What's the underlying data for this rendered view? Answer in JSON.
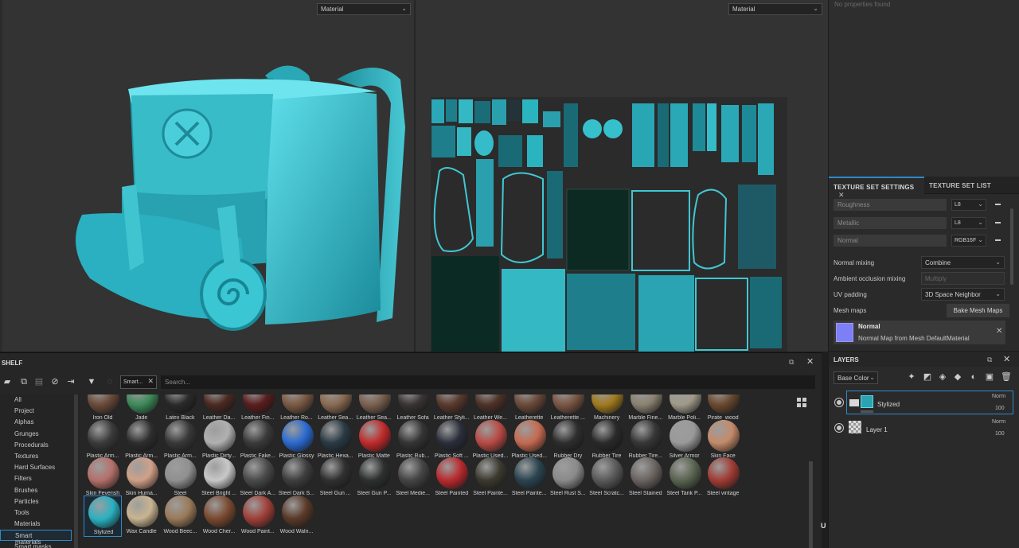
{
  "viewport_3d": {
    "mode_label": "Material"
  },
  "viewport_2d": {
    "mode_label": "Material"
  },
  "properties": {
    "empty_text": "No properties found"
  },
  "texture_set": {
    "tabs": [
      "TEXTURE SET SETTINGS",
      "TEXTURE SET LIST"
    ],
    "channels": [
      {
        "name": "Roughness",
        "format": "L8"
      },
      {
        "name": "Metallic",
        "format": "L8"
      },
      {
        "name": "Normal",
        "format": "RGB16F"
      }
    ],
    "normal_mixing": {
      "label": "Normal mixing",
      "value": "Combine"
    },
    "ao_mixing": {
      "label": "Ambient occlusion mixing",
      "value": "Multiply"
    },
    "uv_padding": {
      "label": "UV padding",
      "value": "3D Space Neighbor"
    },
    "mesh_maps": {
      "label": "Mesh maps",
      "button": "Bake Mesh Maps"
    },
    "mesh_map_item": {
      "title": "Normal",
      "subtitle": "Normal Map from Mesh DefaultMaterial"
    }
  },
  "layers": {
    "title": "LAYERS",
    "blend_channel": "Base Color",
    "items": [
      {
        "name": "Stylized",
        "blend": "Norm",
        "opacity": "100"
      },
      {
        "name": "Layer 1",
        "blend": "Norm",
        "opacity": "100"
      }
    ]
  },
  "shelf": {
    "title": "SHELF",
    "filter_chip": "Smart...",
    "search_placeholder": "Search...",
    "categories": [
      "All",
      "Project",
      "Alphas",
      "Grunges",
      "Procedurals",
      "Textures",
      "Hard Surfaces",
      "Filters",
      "Brushes",
      "Particles",
      "Tools",
      "Materials",
      "Smart materials",
      "Smart masks"
    ],
    "selected_category": "Smart materials",
    "materials": [
      {
        "name": "Iron Old",
        "color": "#6b4a3a"
      },
      {
        "name": "Jade",
        "color": "#3e8a5a"
      },
      {
        "name": "Latex Black",
        "color": "#2a2a2a"
      },
      {
        "name": "Leather Da...",
        "color": "#4a2a22"
      },
      {
        "name": "Leather Fin...",
        "color": "#5a1e1e"
      },
      {
        "name": "Leather Ro...",
        "color": "#7a5a44"
      },
      {
        "name": "Leather Sea...",
        "color": "#8a6a52"
      },
      {
        "name": "Leather Sea...",
        "color": "#7a6050"
      },
      {
        "name": "Leather Sofa",
        "color": "#3a3434"
      },
      {
        "name": "Leather Styli...",
        "color": "#5a3a2e"
      },
      {
        "name": "Leather We...",
        "color": "#4e3228"
      },
      {
        "name": "Leatherette",
        "color": "#6a4a3a"
      },
      {
        "name": "Leatherette ...",
        "color": "#7a5644"
      },
      {
        "name": "Machinery",
        "color": "#a07a20"
      },
      {
        "name": "Marble Fine...",
        "color": "#8a8272"
      },
      {
        "name": "Marble Poli...",
        "color": "#a09a8a"
      },
      {
        "name": "Pirate_wood",
        "color": "#6a4a30"
      },
      {
        "name": "Plastic Arm...",
        "color": "#3a3a3a"
      },
      {
        "name": "Plastic Arm...",
        "color": "#2e2e2e"
      },
      {
        "name": "Plastic Arm...",
        "color": "#383838"
      },
      {
        "name": "Plastic Dirty...",
        "color": "#b0b0b0"
      },
      {
        "name": "Plastic Fake...",
        "color": "#3a3a3a"
      },
      {
        "name": "Plastic Glossy",
        "color": "#2a6ad0"
      },
      {
        "name": "Plastic Hexa...",
        "color": "#2a3a44"
      },
      {
        "name": "Plastic Matte",
        "color": "#c02a2a"
      },
      {
        "name": "Plastic Rub...",
        "color": "#343434"
      },
      {
        "name": "Plastic Soft ...",
        "color": "#2a2e3a"
      },
      {
        "name": "Plastic Used...",
        "color": "#b84a44"
      },
      {
        "name": "Plastic Used...",
        "color": "#c46a50"
      },
      {
        "name": "Rubber Dry",
        "color": "#2e2e2e"
      },
      {
        "name": "Rubber Tire",
        "color": "#2a2a2a"
      },
      {
        "name": "Rubber Tire...",
        "color": "#363636"
      },
      {
        "name": "Silver Armor",
        "color": "#9a9a9a"
      },
      {
        "name": "Skin Face",
        "color": "#c48a6a"
      },
      {
        "name": "Skin Feverish",
        "color": "#b4706a"
      },
      {
        "name": "Skin Huma...",
        "color": "#d0a088"
      },
      {
        "name": "Steel",
        "color": "#909090"
      },
      {
        "name": "Steel Bright ...",
        "color": "#c8c8c8"
      },
      {
        "name": "Steel Dark A...",
        "color": "#4a4a4a"
      },
      {
        "name": "Steel Dark S...",
        "color": "#3e3e3e"
      },
      {
        "name": "Steel Gun ...",
        "color": "#303030"
      },
      {
        "name": "Steel Gun P...",
        "color": "#2e3030"
      },
      {
        "name": "Steel Medie...",
        "color": "#444"
      },
      {
        "name": "Steel Painted",
        "color": "#b82a2e"
      },
      {
        "name": "Steel Painte...",
        "color": "#3a3a30"
      },
      {
        "name": "Steel Painte...",
        "color": "#2a4450"
      },
      {
        "name": "Steel Rust S...",
        "color": "#8a8a8a"
      },
      {
        "name": "Steel Scratc...",
        "color": "#5a5a5a"
      },
      {
        "name": "Steel Stained",
        "color": "#6a6460"
      },
      {
        "name": "Steel Tank P...",
        "color": "#5a6450"
      },
      {
        "name": "Steel vintage",
        "color": "#a03c34"
      },
      {
        "name": "Stylized",
        "color": "#2ab0c0"
      },
      {
        "name": "Wax Candle",
        "color": "#c8b490"
      },
      {
        "name": "Wood Beec...",
        "color": "#9a7a5a"
      },
      {
        "name": "Wood Cher...",
        "color": "#7a4a30"
      },
      {
        "name": "Wood Paint...",
        "color": "#a04038"
      },
      {
        "name": "Wood Waln...",
        "color": "#5a3a28"
      }
    ],
    "selected_material": "Stylized"
  },
  "colors": {
    "accent": "#2d8ac8",
    "teal": "#2ab0c0"
  }
}
